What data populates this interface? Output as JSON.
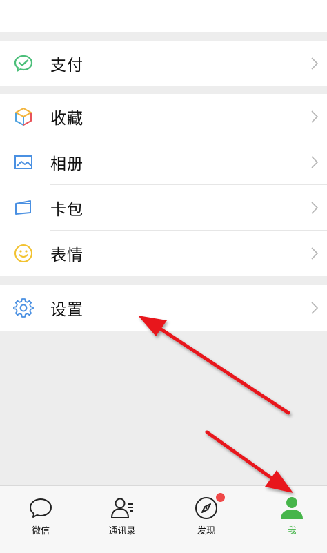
{
  "menu": {
    "pay": "支付",
    "favorites": "收藏",
    "album": "相册",
    "cards": "卡包",
    "stickers": "表情",
    "settings": "设置"
  },
  "tabs": [
    {
      "label": "微信",
      "icon": "chat-bubble-icon"
    },
    {
      "label": "通讯录",
      "icon": "contacts-icon"
    },
    {
      "label": "发现",
      "icon": "compass-icon"
    },
    {
      "label": "我",
      "icon": "person-icon"
    }
  ],
  "colors": {
    "active_tab": "#46b54a",
    "badge": "#f04848",
    "annotation_arrow": "#e8161b"
  }
}
